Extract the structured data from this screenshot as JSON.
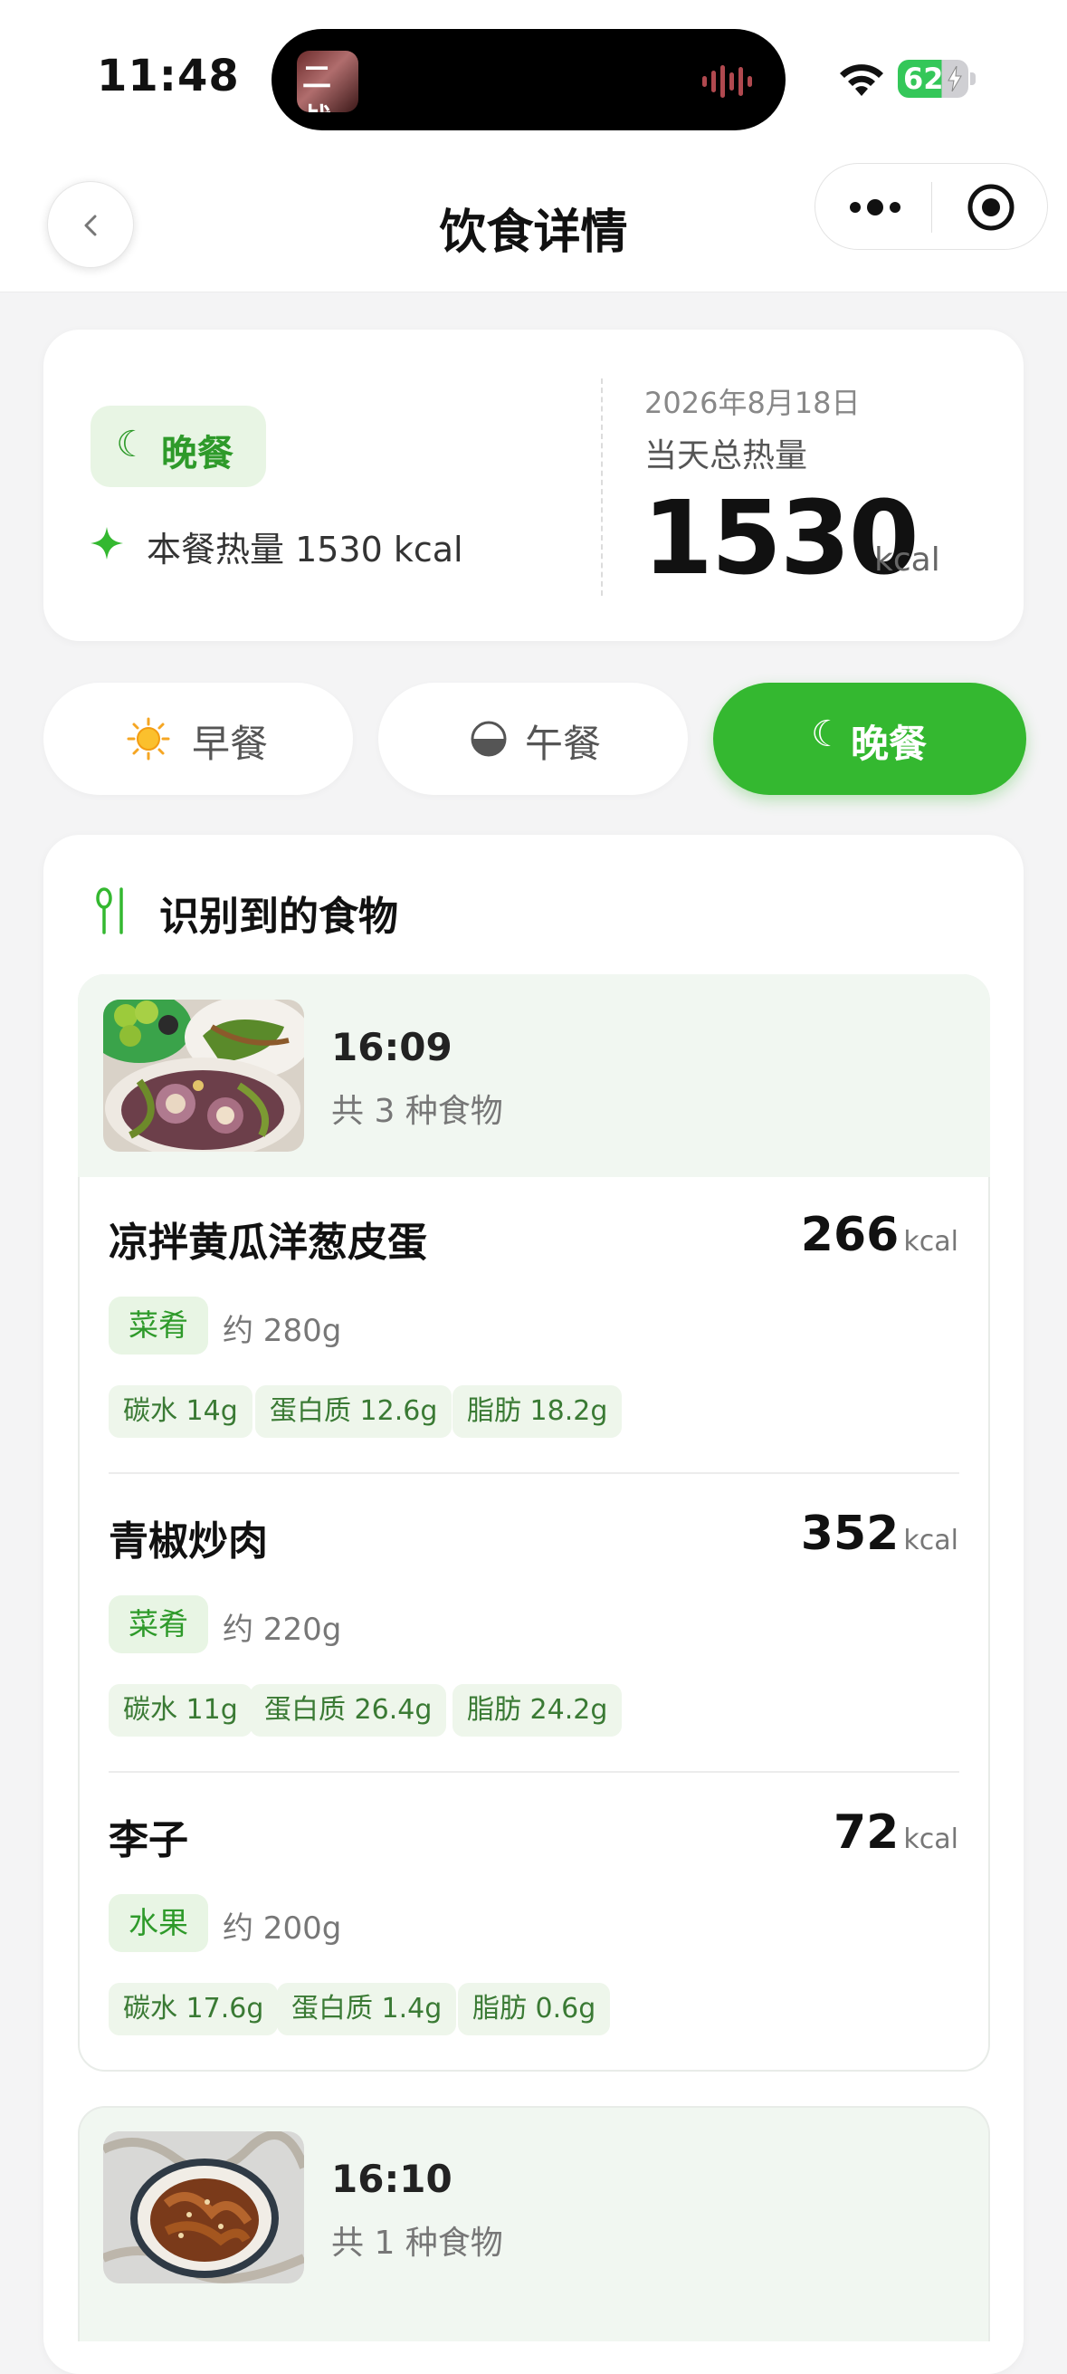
{
  "status_bar": {
    "time": "11:48",
    "island_label": "二战",
    "battery": "62"
  },
  "nav": {
    "title": "饮食详情"
  },
  "summary": {
    "meal_chip": "晚餐",
    "meal_chip_icon": "☾",
    "meal_calories_text": "本餐热量 1530 kcal",
    "date": "2026年8月18日",
    "total_label": "当天总热量",
    "total_value": "1530",
    "total_unit": "kcal"
  },
  "tabs": [
    {
      "label": "早餐",
      "icon": "sun-icon",
      "active": false
    },
    {
      "label": "午餐",
      "icon": "half-circle-icon",
      "active": false
    },
    {
      "label": "晚餐",
      "icon": "moon-icon",
      "active": true
    }
  ],
  "moon_glyph": "☾",
  "section": {
    "title": "识别到的食物"
  },
  "groups": [
    {
      "time": "16:09",
      "count_text": "共 3 种食物",
      "foods": [
        {
          "name": "凉拌黄瓜洋葱皮蛋",
          "kcal": "266",
          "unit": "kcal",
          "category": "菜肴",
          "weight": "约 280g",
          "nutrients": [
            "碳水 14g",
            "蛋白质 12.6g",
            "脂肪 18.2g"
          ]
        },
        {
          "name": "青椒炒肉",
          "kcal": "352",
          "unit": "kcal",
          "category": "菜肴",
          "weight": "约 220g",
          "nutrients": [
            "碳水 11g",
            "蛋白质 26.4g",
            "脂肪 24.2g"
          ]
        },
        {
          "name": "李子",
          "kcal": "72",
          "unit": "kcal",
          "category": "水果",
          "weight": "约 200g",
          "nutrients": [
            "碳水 17.6g",
            "蛋白质 1.4g",
            "脂肪 0.6g"
          ]
        }
      ]
    },
    {
      "time": "16:10",
      "count_text": "共 1 种食物"
    }
  ],
  "colors": {
    "accent": "#34b830",
    "accent_text": "#2e9a2a",
    "chip_bg": "#e8f5e4",
    "page_bg": "#f4f4f5"
  }
}
